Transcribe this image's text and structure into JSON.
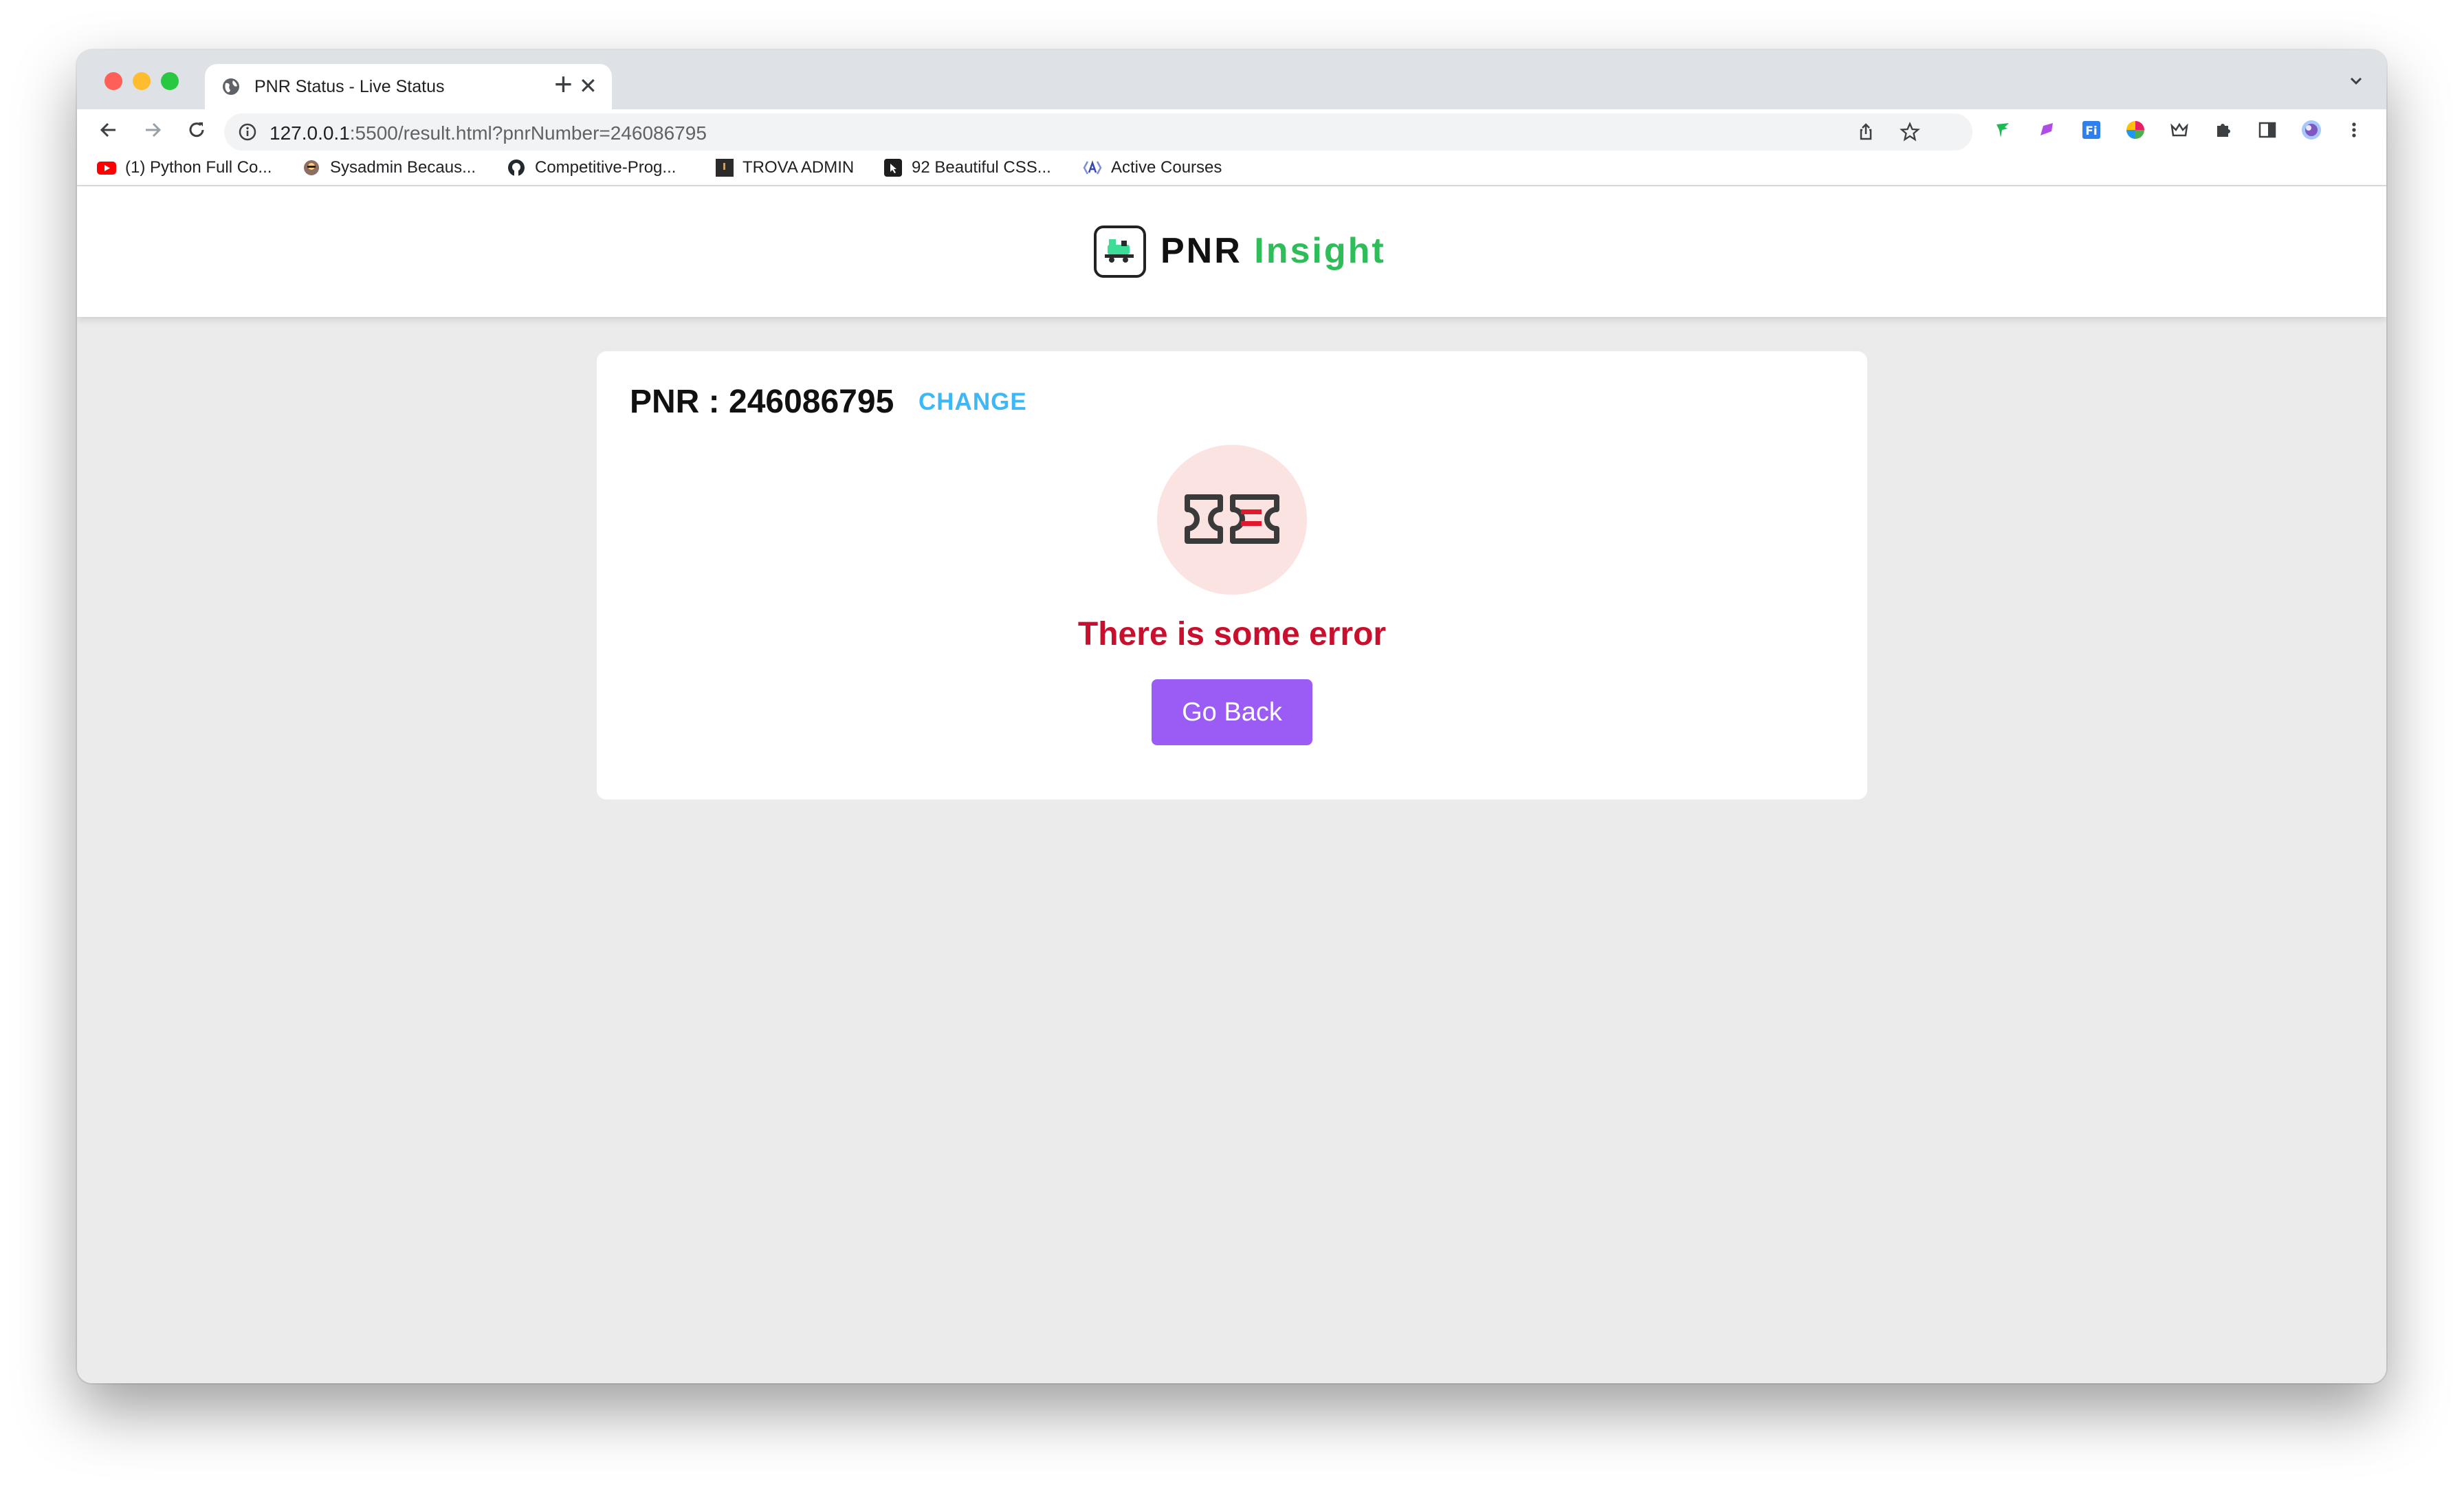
{
  "browser": {
    "tab": {
      "title": "PNR Status - Live Status"
    },
    "url": {
      "host": "127.0.0.1",
      "rest": ":5500/result.html?pnrNumber=246086795"
    },
    "bookmarks": [
      {
        "label": "(1) Python Full Co...",
        "icon": "youtube-icon"
      },
      {
        "label": "Sysadmin Becaus...",
        "icon": "avatar-icon"
      },
      {
        "label": "Competitive-Prog...",
        "icon": "github-icon"
      },
      {
        "label": "TROVA ADMIN",
        "icon": "trova-icon"
      },
      {
        "label": "92 Beautiful CSS...",
        "icon": "css-icon"
      },
      {
        "label": "Active Courses",
        "icon": "courses-icon"
      }
    ]
  },
  "site": {
    "logo": {
      "pnr": "PNR",
      "insight": "Insight"
    }
  },
  "result": {
    "pnr_label": "PNR : 246086795",
    "change_label": "CHANGE",
    "error_message": "There is some error",
    "go_back_label": "Go Back"
  },
  "colors": {
    "accent_purple": "#9b5cf6",
    "error_red": "#c8102e",
    "link_blue": "#3db7f5",
    "brand_green": "#2ebd59"
  }
}
